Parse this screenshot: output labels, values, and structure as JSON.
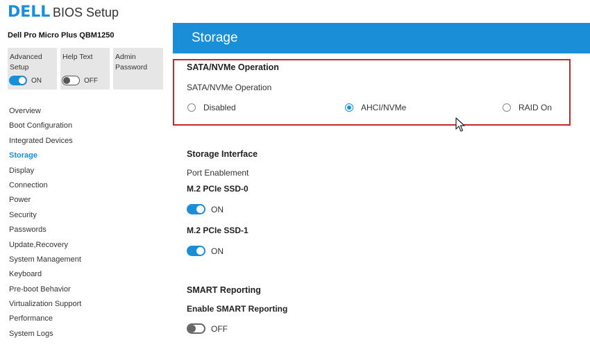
{
  "header": {
    "logo_text": "DELL",
    "app_title": "BIOS Setup",
    "device_name": "Dell Pro Micro Plus QBM1250"
  },
  "tiles": [
    {
      "label_line1": "Advanced",
      "label_line2": "Setup",
      "toggle_state": "on",
      "toggle_text": "ON"
    },
    {
      "label_line1": "Help Text",
      "label_line2": "",
      "toggle_state": "off",
      "toggle_text": "OFF"
    },
    {
      "label_line1": "Admin",
      "label_line2": "Password"
    }
  ],
  "sidebar": {
    "items": [
      {
        "label": "Overview"
      },
      {
        "label": "Boot Configuration"
      },
      {
        "label": "Integrated Devices"
      },
      {
        "label": "Storage",
        "active": true
      },
      {
        "label": "Display"
      },
      {
        "label": "Connection"
      },
      {
        "label": "Power"
      },
      {
        "label": "Security"
      },
      {
        "label": "Passwords"
      },
      {
        "label": "Update,Recovery"
      },
      {
        "label": "System Management"
      },
      {
        "label": "Keyboard"
      },
      {
        "label": "Pre-boot Behavior"
      },
      {
        "label": "Virtualization Support"
      },
      {
        "label": "Performance"
      },
      {
        "label": "System Logs"
      }
    ]
  },
  "main": {
    "title": "Storage",
    "sata": {
      "section_title": "SATA/NVMe Operation",
      "field_label": "SATA/NVMe Operation",
      "options": [
        {
          "label": "Disabled",
          "selected": false
        },
        {
          "label": "AHCI/NVMe",
          "selected": true
        },
        {
          "label": "RAID On",
          "selected": false
        }
      ]
    },
    "storage_interface": {
      "section_title": "Storage Interface",
      "port_label": "Port Enablement",
      "ports": [
        {
          "label": "M.2 PCIe SSD-0",
          "toggle_state": "on",
          "toggle_text": "ON"
        },
        {
          "label": "M.2 PCIe SSD-1",
          "toggle_state": "on",
          "toggle_text": "ON"
        }
      ]
    },
    "smart": {
      "section_title": "SMART Reporting",
      "field_label": "Enable SMART Reporting",
      "toggle_state": "off",
      "toggle_text": "OFF"
    }
  },
  "colors": {
    "accent": "#1a8fd8",
    "highlight_border": "#c8262f",
    "tile_bg": "#e6e6e6"
  },
  "icons": {
    "cursor": "mouse-pointer-icon"
  }
}
